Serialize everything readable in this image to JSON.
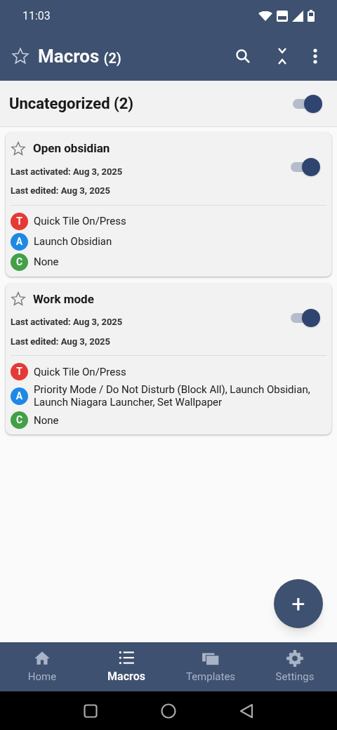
{
  "status_bar": {
    "time": "11:03"
  },
  "app_bar": {
    "title": "Macros",
    "count": "(2)"
  },
  "category": {
    "title": "Uncategorized (2)",
    "on": true
  },
  "macros": [
    {
      "name": "Open obsidian",
      "starred": false,
      "on": true,
      "last_activated": "Last activated: Aug 3, 2025",
      "last_edited": "Last edited: Aug 3, 2025",
      "parts": [
        {
          "letter": "T",
          "color": "#e53935",
          "text": "Quick Tile On/Press"
        },
        {
          "letter": "A",
          "color": "#1e88e5",
          "text": "Launch Obsidian"
        },
        {
          "letter": "C",
          "color": "#43a047",
          "text": "None"
        }
      ]
    },
    {
      "name": "Work mode",
      "starred": false,
      "on": true,
      "last_activated": "Last activated: Aug 3, 2025",
      "last_edited": "Last edited: Aug 3, 2025",
      "parts": [
        {
          "letter": "T",
          "color": "#e53935",
          "text": "Quick Tile On/Press"
        },
        {
          "letter": "A",
          "color": "#1e88e5",
          "text": "Priority Mode / Do Not Disturb (Block All), Launch Obsidian, Launch Niagara Launcher, Set Wallpaper"
        },
        {
          "letter": "C",
          "color": "#43a047",
          "text": "None"
        }
      ]
    }
  ],
  "fab": "+",
  "bottom_nav": [
    {
      "kind": "home",
      "label": "Home",
      "selected": false
    },
    {
      "kind": "list",
      "label": "Macros",
      "selected": true
    },
    {
      "kind": "templates",
      "label": "Templates",
      "selected": false
    },
    {
      "kind": "settings",
      "label": "Settings",
      "selected": false
    }
  ]
}
